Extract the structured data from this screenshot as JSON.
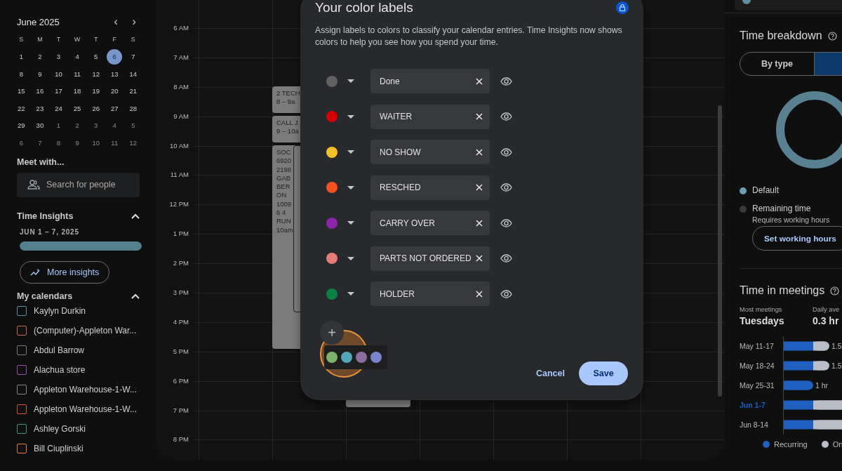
{
  "mini_calendar": {
    "title": "June 2025",
    "prev": "‹",
    "next": "›",
    "weekdays": [
      "S",
      "M",
      "T",
      "W",
      "T",
      "F",
      "S"
    ],
    "weeks": [
      [
        {
          "day": "1",
          "other_month": false,
          "selected": false
        },
        {
          "day": "2",
          "other_month": false,
          "selected": false
        },
        {
          "day": "3",
          "other_month": false,
          "selected": false
        },
        {
          "day": "4",
          "other_month": false,
          "selected": false
        },
        {
          "day": "5",
          "other_month": false,
          "selected": false
        },
        {
          "day": "6",
          "other_month": false,
          "selected": true
        },
        {
          "day": "7",
          "other_month": false,
          "selected": false
        }
      ],
      [
        {
          "day": "8",
          "other_month": false,
          "selected": false
        },
        {
          "day": "9",
          "other_month": false,
          "selected": false
        },
        {
          "day": "10",
          "other_month": false,
          "selected": false
        },
        {
          "day": "11",
          "other_month": false,
          "selected": false
        },
        {
          "day": "12",
          "other_month": false,
          "selected": false
        },
        {
          "day": "13",
          "other_month": false,
          "selected": false
        },
        {
          "day": "14",
          "other_month": false,
          "selected": false
        }
      ],
      [
        {
          "day": "15",
          "other_month": false,
          "selected": false
        },
        {
          "day": "16",
          "other_month": false,
          "selected": false
        },
        {
          "day": "17",
          "other_month": false,
          "selected": false
        },
        {
          "day": "18",
          "other_month": false,
          "selected": false
        },
        {
          "day": "19",
          "other_month": false,
          "selected": false
        },
        {
          "day": "20",
          "other_month": false,
          "selected": false
        },
        {
          "day": "21",
          "other_month": false,
          "selected": false
        }
      ],
      [
        {
          "day": "22",
          "other_month": false,
          "selected": false
        },
        {
          "day": "23",
          "other_month": false,
          "selected": false
        },
        {
          "day": "24",
          "other_month": false,
          "selected": false
        },
        {
          "day": "25",
          "other_month": false,
          "selected": false
        },
        {
          "day": "26",
          "other_month": false,
          "selected": false
        },
        {
          "day": "27",
          "other_month": false,
          "selected": false
        },
        {
          "day": "28",
          "other_month": false,
          "selected": false
        }
      ],
      [
        {
          "day": "29",
          "other_month": false,
          "selected": false
        },
        {
          "day": "30",
          "other_month": false,
          "selected": false
        },
        {
          "day": "1",
          "other_month": true,
          "selected": false
        },
        {
          "day": "2",
          "other_month": true,
          "selected": false
        },
        {
          "day": "3",
          "other_month": true,
          "selected": false
        },
        {
          "day": "4",
          "other_month": true,
          "selected": false
        },
        {
          "day": "5",
          "other_month": true,
          "selected": false
        }
      ],
      [
        {
          "day": "6",
          "other_month": true,
          "selected": false
        },
        {
          "day": "7",
          "other_month": true,
          "selected": false
        },
        {
          "day": "8",
          "other_month": true,
          "selected": false
        },
        {
          "day": "9",
          "other_month": true,
          "selected": false
        },
        {
          "day": "10",
          "other_month": true,
          "selected": false
        },
        {
          "day": "11",
          "other_month": true,
          "selected": false
        },
        {
          "day": "12",
          "other_month": true,
          "selected": false
        }
      ]
    ]
  },
  "meet_with": {
    "title": "Meet with...",
    "search": {
      "placeholder": "Search for people"
    }
  },
  "time_insights": {
    "title": "Time Insights",
    "expanded": true,
    "range": "JUN 1 – 7, 2025",
    "level": 1,
    "button": "More insights"
  },
  "my_calendars": {
    "title": "My calendars",
    "expanded": true,
    "items": [
      {
        "name": "Kaylyn Durkin",
        "color": "#5f8ea0",
        "checked": false
      },
      {
        "name": "(Computer)-Appleton War...",
        "color": "#c2694f",
        "checked": false
      },
      {
        "name": "Abdul Barrow",
        "color": "#7a7a7a",
        "checked": false
      },
      {
        "name": "Alachua store",
        "color": "#9b4bb0",
        "checked": false
      },
      {
        "name": "Appleton Warehouse-1-W...",
        "color": "#858585",
        "checked": false
      },
      {
        "name": "Appleton Warehouse-1-W...",
        "color": "#d2543a",
        "checked": false
      },
      {
        "name": "Ashley Gorski",
        "color": "#3d9a6b",
        "checked": false
      },
      {
        "name": "Bill Ciuplinski",
        "color": "#e07b39",
        "checked": false
      }
    ]
  },
  "calendar": {
    "hours": [
      "6 AM",
      "7 AM",
      "8 AM",
      "9 AM",
      "10 AM",
      "11 AM",
      "12 PM",
      "1 PM",
      "2 PM",
      "3 PM",
      "4 PM",
      "5 PM",
      "6 PM",
      "7 PM",
      "8 PM"
    ],
    "events": [
      {
        "kind": "plain",
        "lines": [
          "2 TECH",
          "8 – 9a"
        ]
      },
      {
        "kind": "plain",
        "lines": [
          "CALL J",
          "9 – 10a"
        ]
      },
      {
        "kind": "plain",
        "lines": [
          "SOC",
          "6920",
          "2198",
          "GAB",
          "BER",
          "ON",
          "1009",
          "6 4",
          "RUN",
          "10am"
        ]
      },
      {
        "kind": "overlap"
      },
      {
        "kind": "plain"
      }
    ]
  },
  "dialog": {
    "title": "Your color labels",
    "description": "Assign labels to colors to classify your calendar entries. Time Insights now shows colors to help you see how you spend your time.",
    "labels": [
      {
        "color": "#616161",
        "value": "Done"
      },
      {
        "color": "#d50000",
        "value": "WAITER"
      },
      {
        "color": "#f6bf26",
        "value": "NO SHOW"
      },
      {
        "color": "#f4511e",
        "value": "RESCHED"
      },
      {
        "color": "#8e24aa",
        "value": "CARRY OVER"
      },
      {
        "color": "#e67c73",
        "value": "PARTS NOT ORDERED"
      },
      {
        "color": "#0b8043",
        "value": "HOLDER"
      }
    ],
    "add": "+",
    "palette": [
      {
        "color": "#7cb56a"
      },
      {
        "color": "#55a5b8"
      },
      {
        "color": "#8a6d9c"
      },
      {
        "color": "#7986cb"
      }
    ],
    "buttons": {
      "cancel": "Cancel",
      "save": "Save"
    }
  },
  "insights_panel": {
    "calendar": {
      "color": "#5f8ea0"
    },
    "breakdown": {
      "title": "Time breakdown",
      "segments": [
        {
          "label": "By type",
          "selected": false
        },
        {
          "selected": true
        }
      ],
      "legend": [
        {
          "name": "Default",
          "color": "#6b9db2"
        },
        {
          "name": "Remaining time",
          "note": "Requires working hours",
          "color": "#3a3a3a"
        }
      ],
      "button": "Set working hours"
    },
    "meetings": {
      "title": "Time in meetings",
      "stats": [
        {
          "label": "Most meetings",
          "value": "Tuesdays"
        },
        {
          "label": "Daily ave",
          "value": "0.3 hr"
        }
      ],
      "weeks": [
        {
          "label": "May 11-17",
          "selected": false,
          "value": "1.5"
        },
        {
          "label": "May 18-24",
          "selected": false,
          "value": "1.5"
        },
        {
          "label": "May 25-31",
          "selected": false,
          "value": "1 hr"
        },
        {
          "label": "Jun 1-7",
          "selected": true
        },
        {
          "label": "Jun 8-14",
          "selected": false
        }
      ],
      "legend": [
        {
          "name": "Recurring",
          "color": "#1f5fbf"
        },
        {
          "name": "On",
          "color": "#b9bdc8"
        }
      ]
    }
  }
}
